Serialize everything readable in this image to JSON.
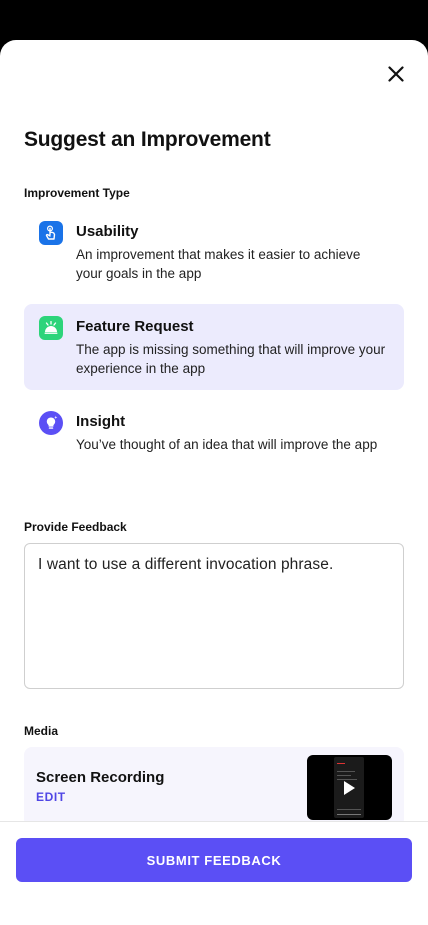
{
  "header": {
    "title": "Suggest an Improvement",
    "close_icon": "close-icon"
  },
  "improvement_type": {
    "label": "Improvement Type",
    "selected": "Feature Request",
    "options": [
      {
        "title": "Usability",
        "description": "An improvement that makes it easier to achieve your goals in the app",
        "icon": "hand-pointer-icon",
        "color": "#1a73e8"
      },
      {
        "title": "Feature Request",
        "description": "The app is missing something that will improve your experience in the app",
        "icon": "sparkle-cloud-icon",
        "color": "#2dd47a"
      },
      {
        "title": "Insight",
        "description": "You’ve thought of an idea that will improve the app",
        "icon": "lightbulb-icon",
        "color": "#5b4ff5"
      }
    ]
  },
  "feedback": {
    "label": "Provide Feedback",
    "value": "I want to use a different invocation phrase."
  },
  "media": {
    "label": "Media",
    "item_title": "Screen Recording",
    "edit_label": "EDIT"
  },
  "footer": {
    "submit_label": "SUBMIT FEEDBACK"
  },
  "colors": {
    "accent": "#5b4ff5",
    "selected_bg": "#ecebfd"
  }
}
